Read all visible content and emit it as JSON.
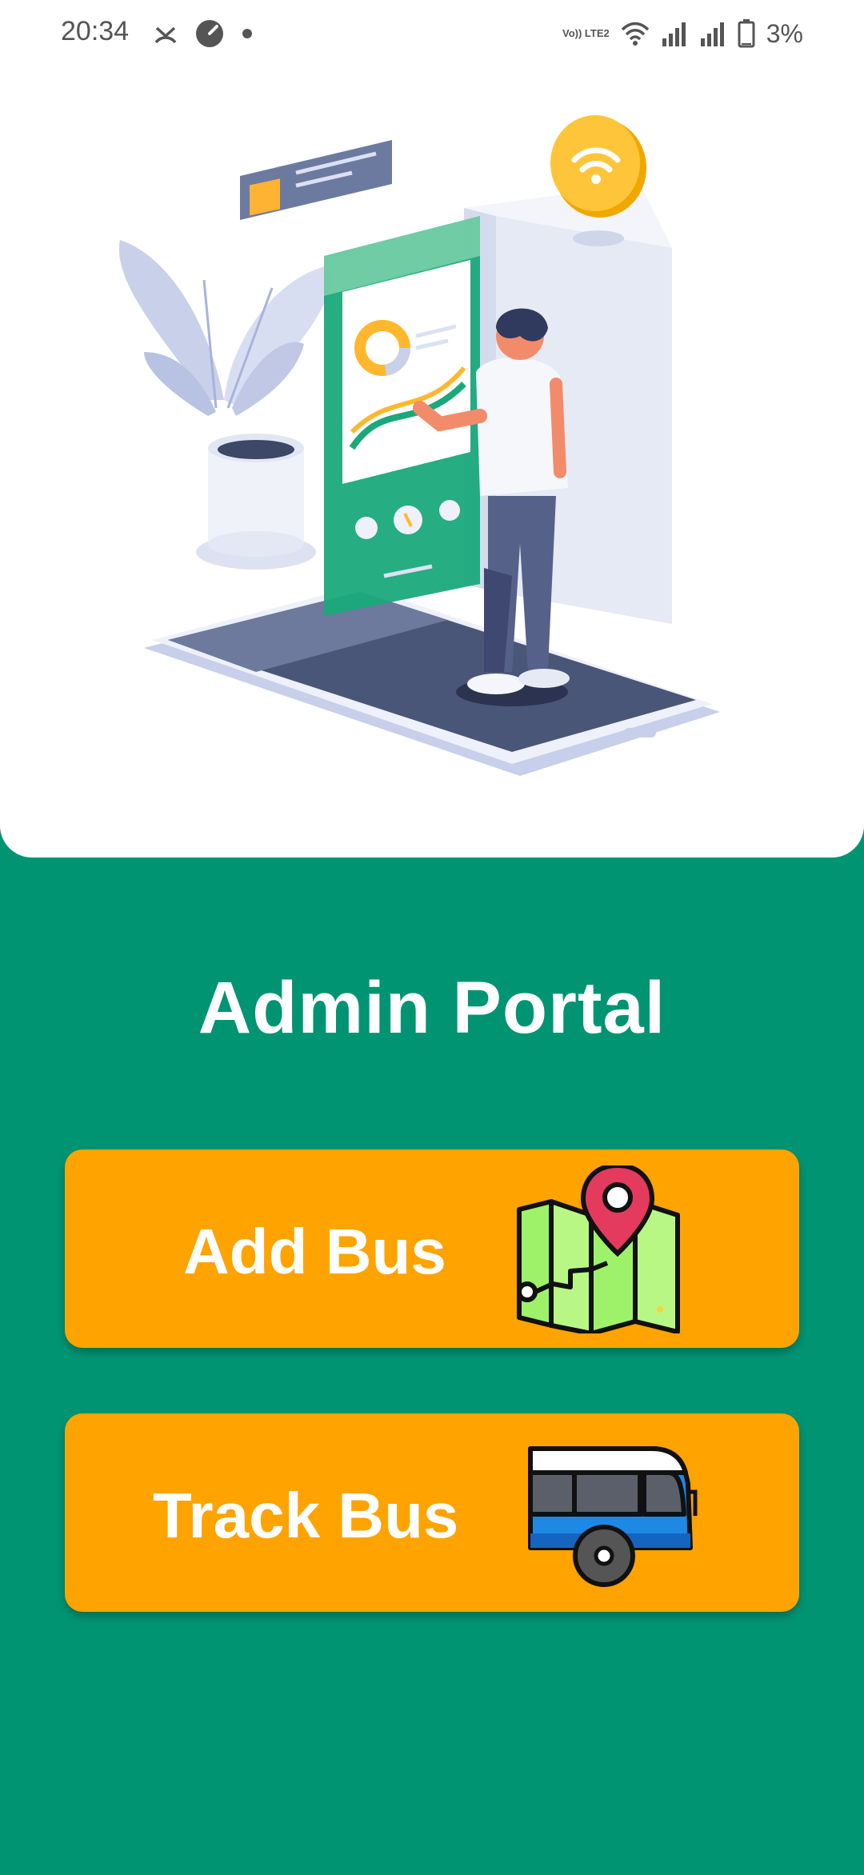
{
  "status_bar": {
    "time": "20:34",
    "battery": "3%",
    "volte": "Vo)) LTE2",
    "icons": [
      "missed-call-icon",
      "speedometer-icon",
      "dot-icon",
      "volte-icon",
      "wifi-icon",
      "signal-icon",
      "signal-icon",
      "battery-icon"
    ]
  },
  "hero": {
    "illustration": "person-using-phone-illustration"
  },
  "page": {
    "title": "Admin Portal"
  },
  "actions": [
    {
      "label": "Add Bus",
      "icon": "map-pin-icon"
    },
    {
      "label": "Track Bus",
      "icon": "bus-icon"
    }
  ],
  "colors": {
    "background": "#009473",
    "button": "#FFA300",
    "hero": "#ffffff",
    "text_on_dark": "#ffffff"
  }
}
